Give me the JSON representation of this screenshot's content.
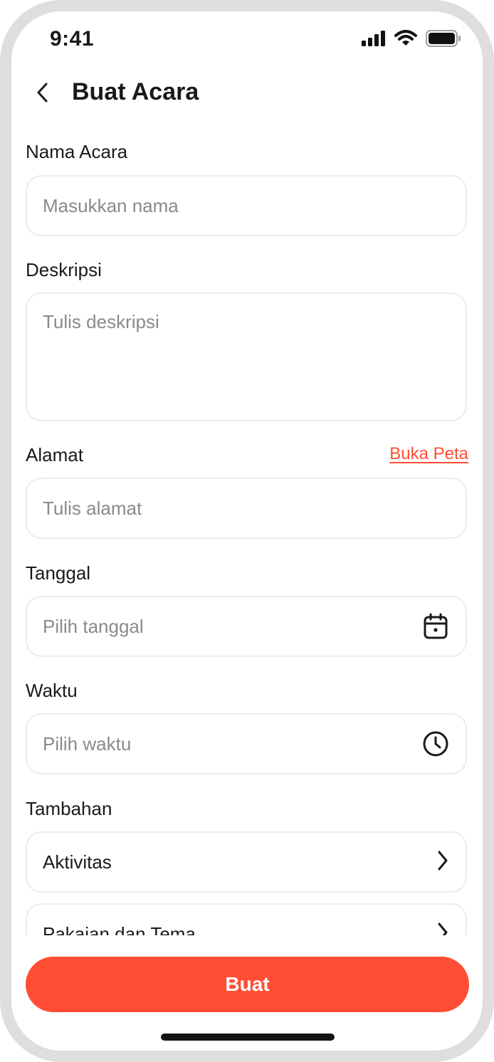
{
  "status_bar": {
    "time": "9:41",
    "icons": [
      "signal-icon",
      "wifi-icon",
      "battery-icon"
    ]
  },
  "header": {
    "back_icon": "chevron-left-icon",
    "title": "Buat Acara"
  },
  "form": {
    "name": {
      "label": "Nama Acara",
      "placeholder": "Masukkan nama",
      "value": ""
    },
    "description": {
      "label": "Deskripsi",
      "placeholder": "Tulis deskripsi",
      "value": ""
    },
    "address": {
      "label": "Alamat",
      "map_link": "Buka Peta",
      "placeholder": "Tulis alamat",
      "value": ""
    },
    "date": {
      "label": "Tanggal",
      "placeholder": "Pilih tanggal",
      "value": "",
      "icon": "calendar-icon"
    },
    "time": {
      "label": "Waktu",
      "placeholder": "Pilih waktu",
      "value": "",
      "icon": "clock-icon"
    },
    "extras": {
      "label": "Tambahan",
      "items": [
        {
          "label": "Aktivitas",
          "icon": "chevron-right-icon"
        },
        {
          "label": "Pakaian dan Tema",
          "icon": "chevron-right-icon"
        }
      ]
    }
  },
  "submit_label": "Buat",
  "colors": {
    "accent": "#ff4e33",
    "border": "#ececec",
    "placeholder": "#8a8a8a",
    "text": "#1a1a1a",
    "frame": "#dedede"
  }
}
